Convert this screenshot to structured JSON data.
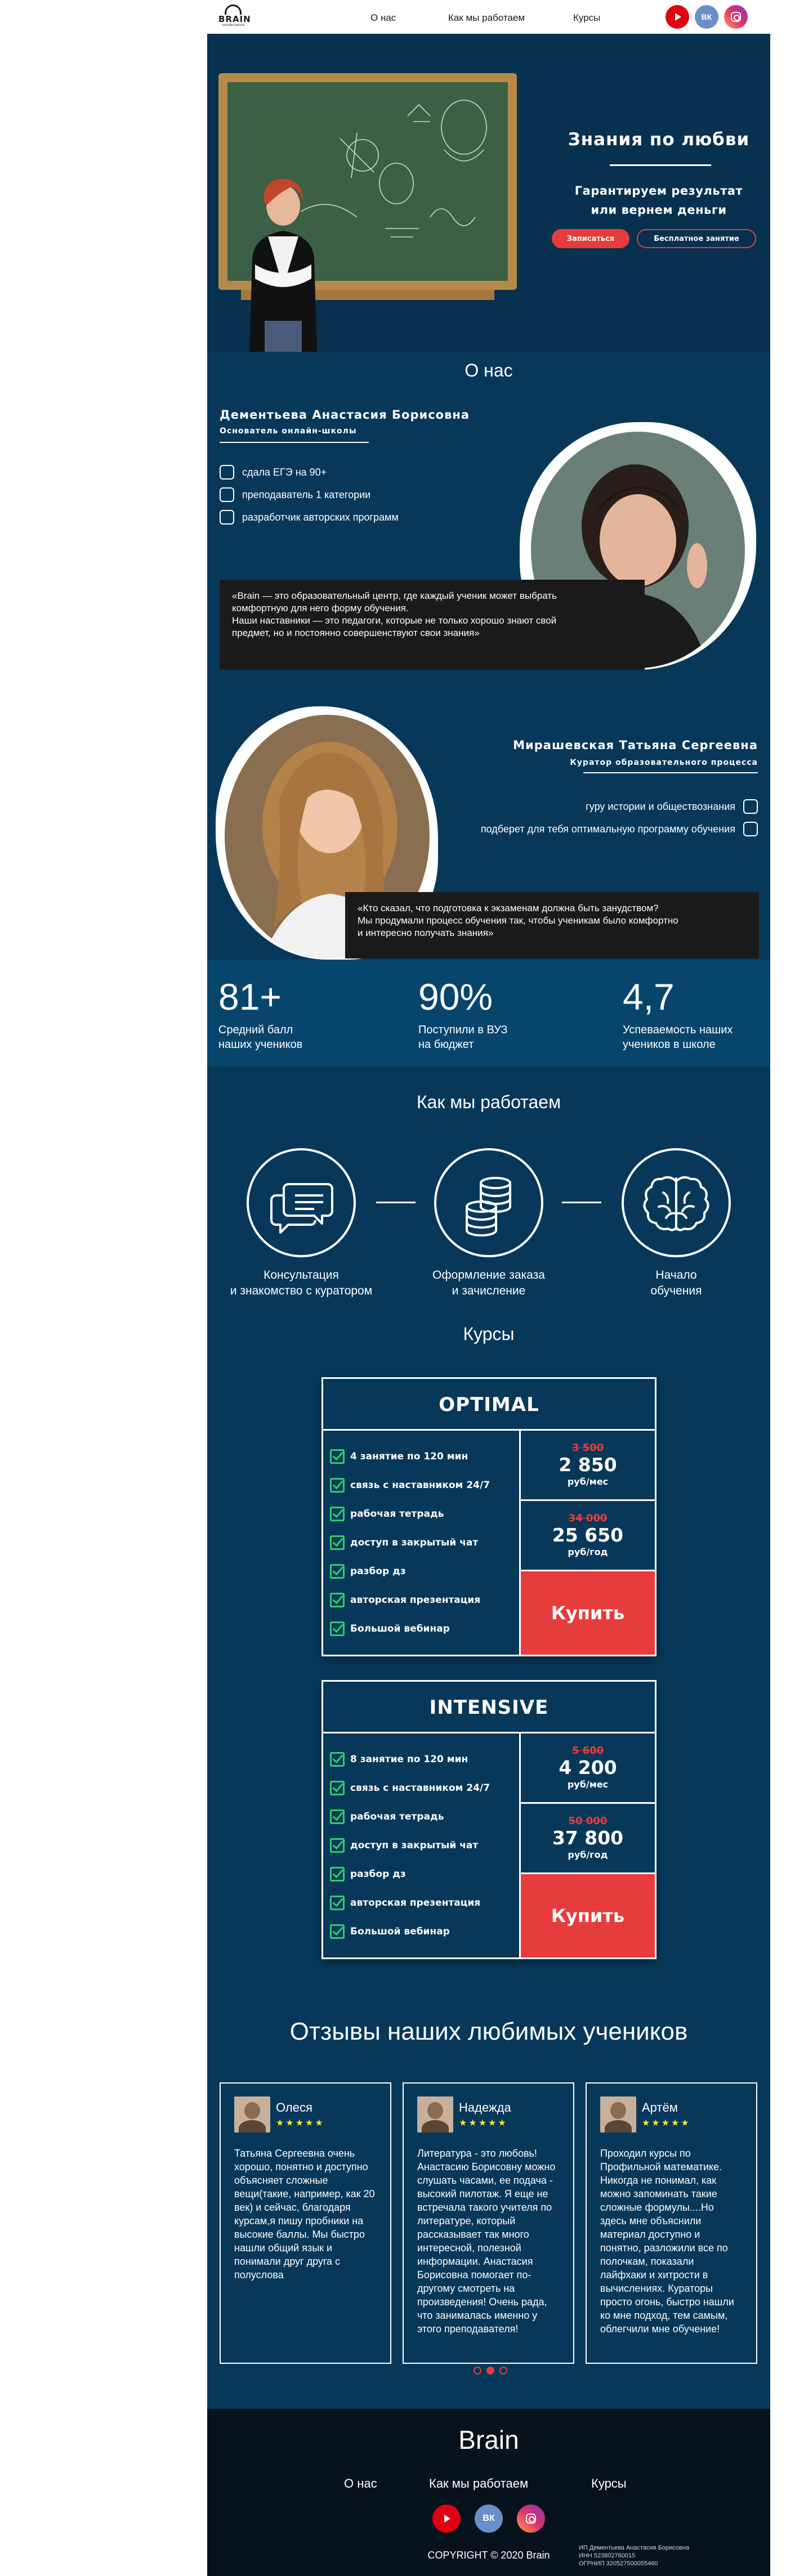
{
  "header": {
    "logo_text": "BRAIN",
    "logo_sub": "онлайн-школа",
    "nav": [
      "О нас",
      "Как мы работаем",
      "Курсы"
    ],
    "social": [
      "youtube-icon",
      "vk-icon",
      "instagram-icon"
    ],
    "vk_label": "ВК"
  },
  "hero": {
    "title": "Знания по любви",
    "subtitle_line1": "Гарантируем результат",
    "subtitle_line2": "или вернем деньги",
    "cta_primary": "Записаться",
    "cta_secondary": "Бесплатное занятие"
  },
  "about": {
    "title": "О нас",
    "name": "Дементьева Анастасия Борисовна",
    "role": "Основатель онлайн-школы",
    "features": [
      "сдала ЕГЭ на 90+",
      "преподаватель 1 категории",
      "разработчик авторских программ"
    ],
    "quote_line1": "«Brain — это образовательный центр, где каждый ученик может выбрать",
    "quote_line2": "комфортную для него форму обучения.",
    "quote_line3": "Наши наставники — это педагоги, которые не только хорошо знают свой",
    "quote_line4": "предмет, но и постоянно совершенствуют свои знания»"
  },
  "curator": {
    "name": "Мирашевская Татьяна Сергеевна",
    "role": "Куратор образовательного процесса",
    "features": [
      "гуру истории и обществознания",
      "подберет для тебя оптимальную программу обучения"
    ],
    "quote_line1": "«Кто сказал, что подготовка к экзаменам должна быть занудством?",
    "quote_line2": "Мы продумали процесс обучения так, чтобы ученикам было комфортно",
    "quote_line3": "и интересно получать знания»"
  },
  "stats": [
    {
      "value": "81+",
      "label1": "Средний балл",
      "label2": "наших учеников"
    },
    {
      "value": "90%",
      "label1": "Поступили в ВУЗ",
      "label2": "на бюджет"
    },
    {
      "value": "4,7",
      "label1": "Успеваемость наших",
      "label2": "учеников в школе"
    }
  ],
  "how": {
    "title": "Как мы работаем",
    "steps": [
      {
        "icon": "chat-icon",
        "line1": "Консультация",
        "line2": "и знакомство с куратором"
      },
      {
        "icon": "coins-icon",
        "line1": "Оформление заказа",
        "line2": "и зачисление"
      },
      {
        "icon": "brain-icon",
        "line1": "Начало",
        "line2": "обучения"
      }
    ]
  },
  "courses": {
    "title": "Курсы",
    "items": [
      {
        "name": "OPTIMAL",
        "features": [
          "4 занятие по 120 мин",
          "связь с наставником 24/7",
          "рабочая тетрадь",
          "доступ в закрытый чат",
          "разбор дз",
          "авторская презентация",
          "Большой вебинар"
        ],
        "price1_old": "3 500",
        "price1_new": "2 850",
        "price1_unit": "руб/мес",
        "price2_old": "34 000",
        "price2_new": "25 650",
        "price2_unit": "руб/год",
        "buy": "Купить"
      },
      {
        "name": "INTENSIVE",
        "features": [
          "8 занятие по 120 мин",
          "связь с наставником 24/7",
          "рабочая тетрадь",
          "доступ в закрытый чат",
          "разбор дз",
          "авторская презентация",
          "Большой вебинар"
        ],
        "price1_old": "5 600",
        "price1_new": "4 200",
        "price1_unit": "руб/мес",
        "price2_old": "50 000",
        "price2_new": "37 800",
        "price2_unit": "руб/год",
        "buy": "Купить"
      }
    ]
  },
  "reviews": {
    "title": "Отзывы наших любимых учеников",
    "items": [
      {
        "name": "Олеся",
        "stars": "★★★★★",
        "text": "Татьяна Сергеевна очень хорошо, понятно и доступно объясняет сложные вещи(такие, например, как 20 век) и сейчас, благодаря курсам,я пишу пробники на высокие баллы. Мы быстро нашли общий язык и понимали друг друга с полуслова"
      },
      {
        "name": "Надежда",
        "stars": "★★★★★",
        "text": "Литература - это любовь! Анастасию Борисовну можно слушать часами, ее подача - высокий пилотаж. Я еще не встречала такого учителя по литературе, который рассказывает так много интересной, полезной информации. Анастасия Борисовна помогает по-другому смотреть на произведения! Очень рада, что занималась именно у этого преподавателя!"
      },
      {
        "name": "Артём",
        "stars": "★★★★★",
        "text": "Проходил курсы по Профильной математике. Никогда не понимал, как можно запоминать такие сложные формулы....Но здесь мне объяснили материал доступно и понятно, разложили все по полочкам, показали лайфхаки и хитрости в вычислениях. Кураторы просто огонь, быстро нашли ко мне подход, тем самым, облегчили мне обучение!"
      }
    ]
  },
  "footer": {
    "brand": "Brain",
    "nav": [
      "О нас",
      "Как мы работаем",
      "Курсы"
    ],
    "copyright": "COPYRIGHT © 2020 Brain",
    "legal1": "ИП Дементьева Анастасия Борисовна",
    "legal2": "ИНН 523802760015",
    "legal3": "ОГРНИП 320527500055460"
  },
  "colors": {
    "accent": "#e63c3c",
    "background": "#07385a",
    "check": "#2fcf6b",
    "stars": "#f7e23a"
  }
}
